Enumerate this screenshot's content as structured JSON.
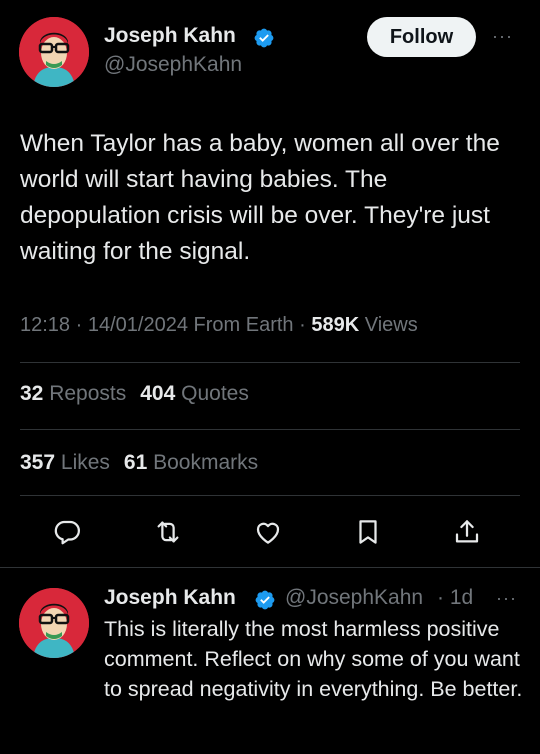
{
  "tweet": {
    "author": {
      "name": "Joseph Kahn",
      "handle": "@JosephKahn"
    },
    "follow_label": "Follow",
    "more_label": "···",
    "text": "When Taylor has a baby, women all over the world will start having babies. The depopulation crisis will be over. They're just waiting for the signal.",
    "meta": {
      "time": "12:18",
      "separator": "·",
      "date": "14/01/2024",
      "source": "From Earth",
      "views_count": "589K",
      "views_label": "Views"
    },
    "stats": {
      "reposts_count": "32",
      "reposts_label": "Reposts",
      "quotes_count": "404",
      "quotes_label": "Quotes",
      "likes_count": "357",
      "likes_label": "Likes",
      "bookmarks_count": "61",
      "bookmarks_label": "Bookmarks"
    },
    "actions": [
      "reply-icon",
      "repost-icon",
      "like-icon",
      "bookmark-icon",
      "share-icon"
    ]
  },
  "reply": {
    "author": {
      "name": "Joseph Kahn",
      "handle": "@JosephKahn",
      "time": "· 1d"
    },
    "more_label": "···",
    "text": "This is literally the most harmless positive comment. Reflect on why some of you want to spread negativity in everything. Be better."
  },
  "colors": {
    "background": "#000000",
    "text": "#e7e9ea",
    "secondary": "#71767b",
    "divider": "#2f3336",
    "verified": "#1d9bf0",
    "avatar_bg": "#d8283a"
  }
}
